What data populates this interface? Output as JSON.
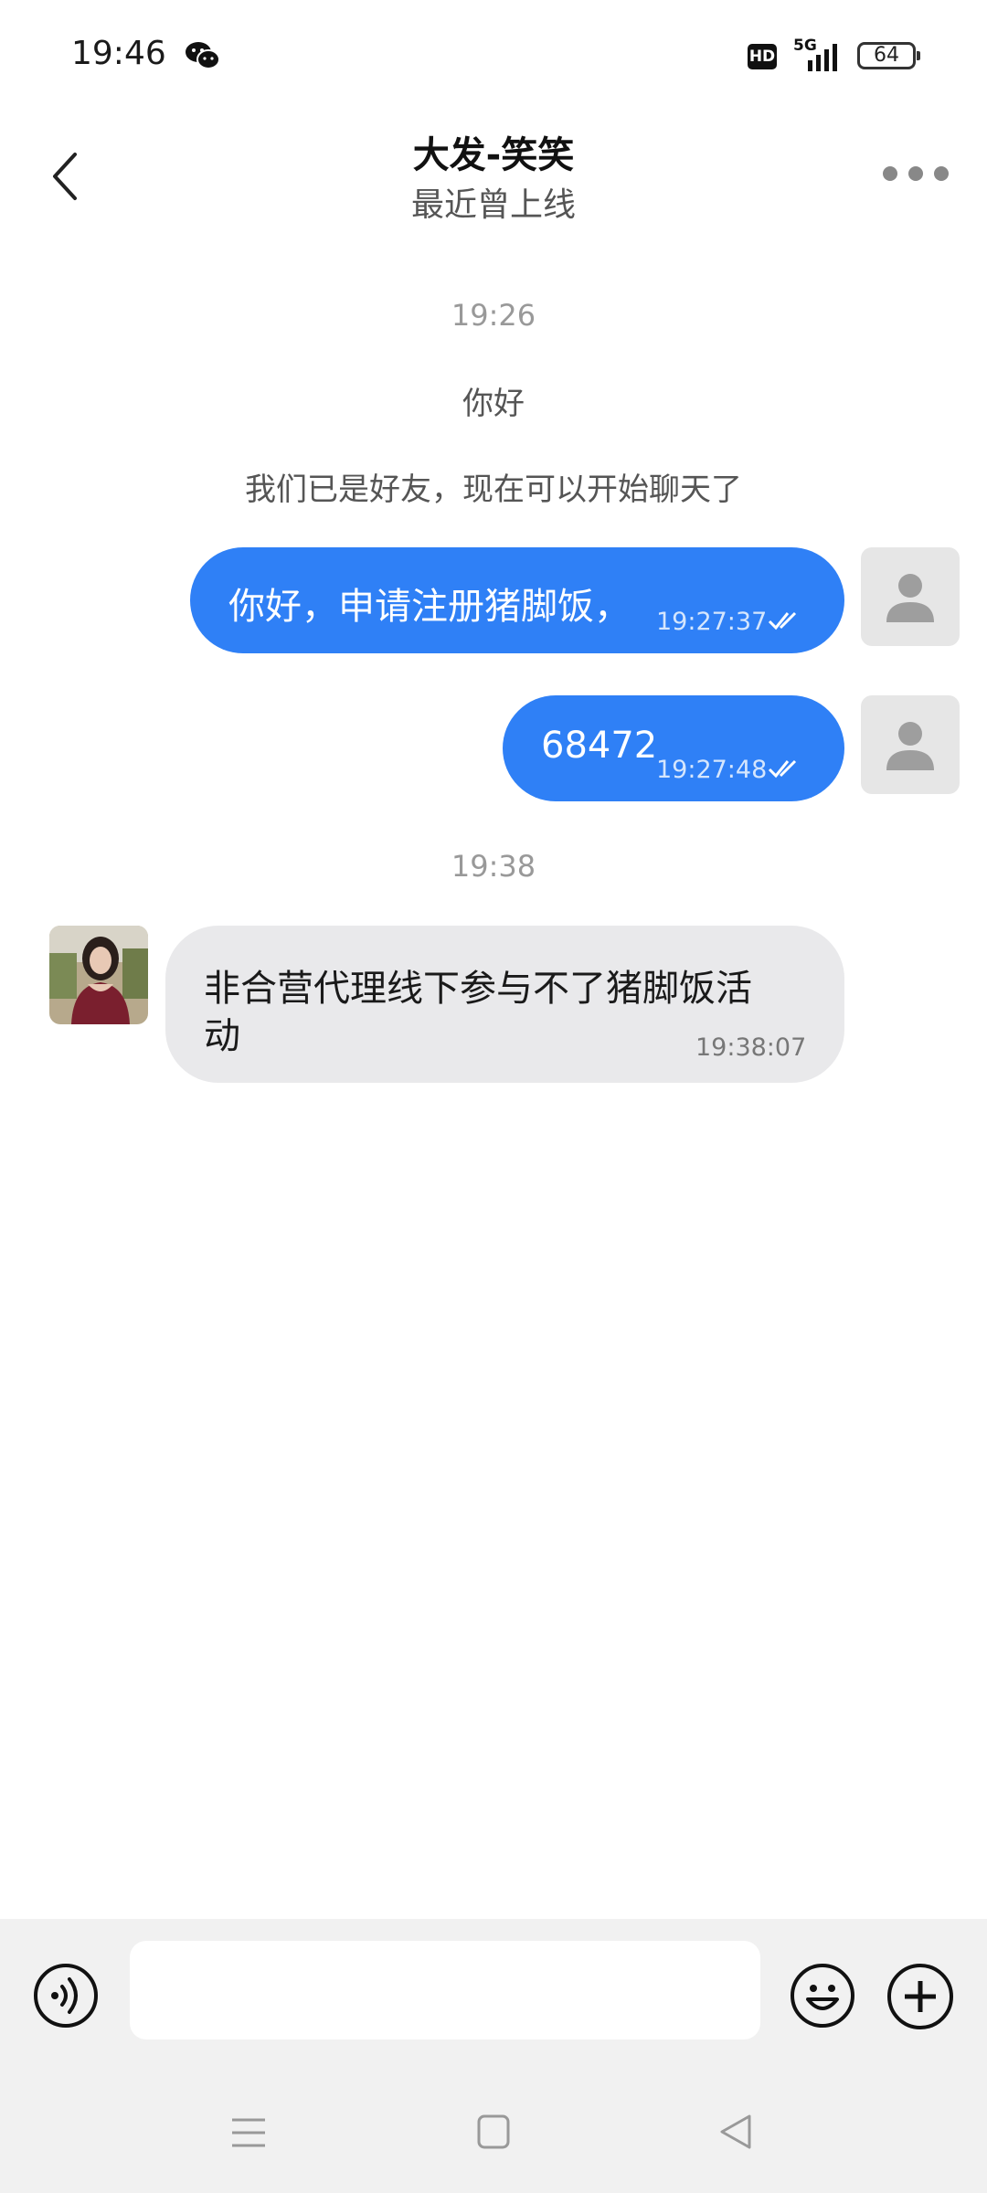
{
  "status_bar": {
    "time": "19:46",
    "app_icon": "wechat-icon",
    "hd": "HD",
    "network": "5G",
    "battery": "64"
  },
  "header": {
    "back_icon": "chevron-left-icon",
    "title": "大发-笑笑",
    "subtitle": "最近曾上线",
    "more_icon": "more-dots-icon"
  },
  "chat": {
    "timestamp_1": "19:26",
    "greeting": "你好",
    "friend_notice": "我们已是好友，现在可以开始聊天了",
    "msg_1": {
      "text": "你好，申请注册猪脚饭，",
      "time": "19:27:37"
    },
    "msg_2": {
      "text": "68472",
      "time": "19:27:48"
    },
    "timestamp_2": "19:38",
    "msg_3": {
      "line1": "非合营代理线下参与不了猪脚饭活",
      "line2": "动",
      "time": "19:38:07"
    }
  },
  "input_bar": {
    "voice_icon": "voice-icon",
    "input_value": "",
    "emoji_icon": "emoji-icon",
    "add_icon": "plus-icon"
  },
  "nav_bar": {
    "menu_icon": "menu-icon",
    "home_icon": "home-icon",
    "back_icon": "back-triangle-icon"
  },
  "colors": {
    "outgoing_bubble": "#2f80f6",
    "incoming_bubble": "#e9e9eb",
    "bar_background": "#f1f1f1"
  }
}
